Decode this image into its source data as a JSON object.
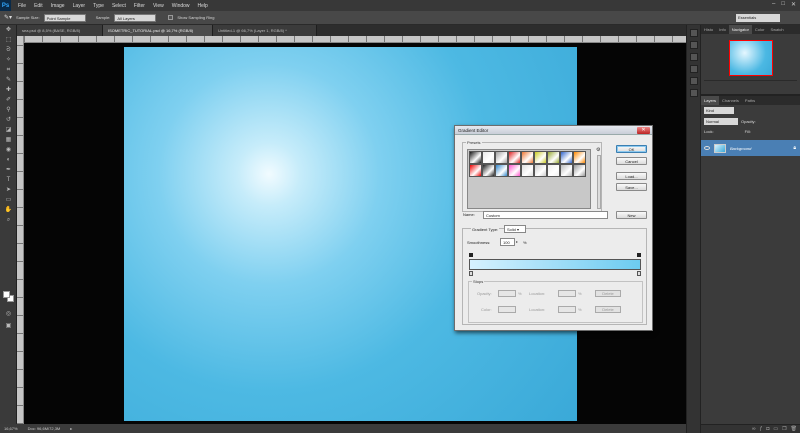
{
  "app": {
    "logo": "Ps"
  },
  "menu": [
    "File",
    "Edit",
    "Image",
    "Layer",
    "Type",
    "Select",
    "Filter",
    "View",
    "Window",
    "Help"
  ],
  "window_controls": [
    "–",
    "□",
    "✕"
  ],
  "options": {
    "sample_size_label": "Sample Size:",
    "sample_size_value": "Point Sample",
    "sample_label": "Sample:",
    "sample_value": "All Layers",
    "show_ring_label": "Show Sampling Ring",
    "workspace": "Essentials"
  },
  "tabs": [
    {
      "label": "sea.psd @ 8,5% (BASE, RGB/8)"
    },
    {
      "label": "ISOMETRIC_TUTORIAL.psd @ 16,7% (RGB/8)"
    },
    {
      "label": "Untitled-1 @ 66,7% (Layer 1, RGB/8) *"
    }
  ],
  "status": {
    "zoom": "16,67%",
    "doc": "Doc: 96,6M/72,3M"
  },
  "panels": {
    "top_tabs": [
      "Histo",
      "Info",
      "Navigator",
      "Color",
      "Swatch"
    ],
    "layer_tabs": [
      "Layers",
      "Channels",
      "Paths"
    ],
    "kind_label": "Kind",
    "blend_mode": "Normal",
    "opacity_label": "Opacity:",
    "lock_label": "Lock:",
    "fill_label": "Fill:",
    "layer_name": "Background"
  },
  "dialog": {
    "title": "Gradient Editor",
    "presets_label": "Presets",
    "ok": "OK",
    "cancel": "Cancel",
    "load": "Load...",
    "save": "Save...",
    "name_label": "Name:",
    "name_value": "Custom",
    "new_btn": "New",
    "gradient_type_label": "Gradient Type:",
    "gradient_type_value": "Solid",
    "smoothness_label": "Smoothness:",
    "smoothness_value": "100",
    "smoothness_unit": "%",
    "stops_label": "Stops",
    "opacity_label": "Opacity:",
    "color_label": "Color:",
    "location_label": "Location:",
    "pct": "%",
    "delete_btn": "Delete",
    "presets": [
      "#1a1a1a",
      "#e8e8e8",
      "#a0a0a0",
      "#d22",
      "#e73",
      "#cc2",
      "#9a3",
      "#36c",
      "#f80",
      "#e00",
      "#222",
      "#38c",
      "#f5c",
      "#ddd",
      "#ccc",
      "#eee",
      "#bbb",
      "#999"
    ]
  }
}
